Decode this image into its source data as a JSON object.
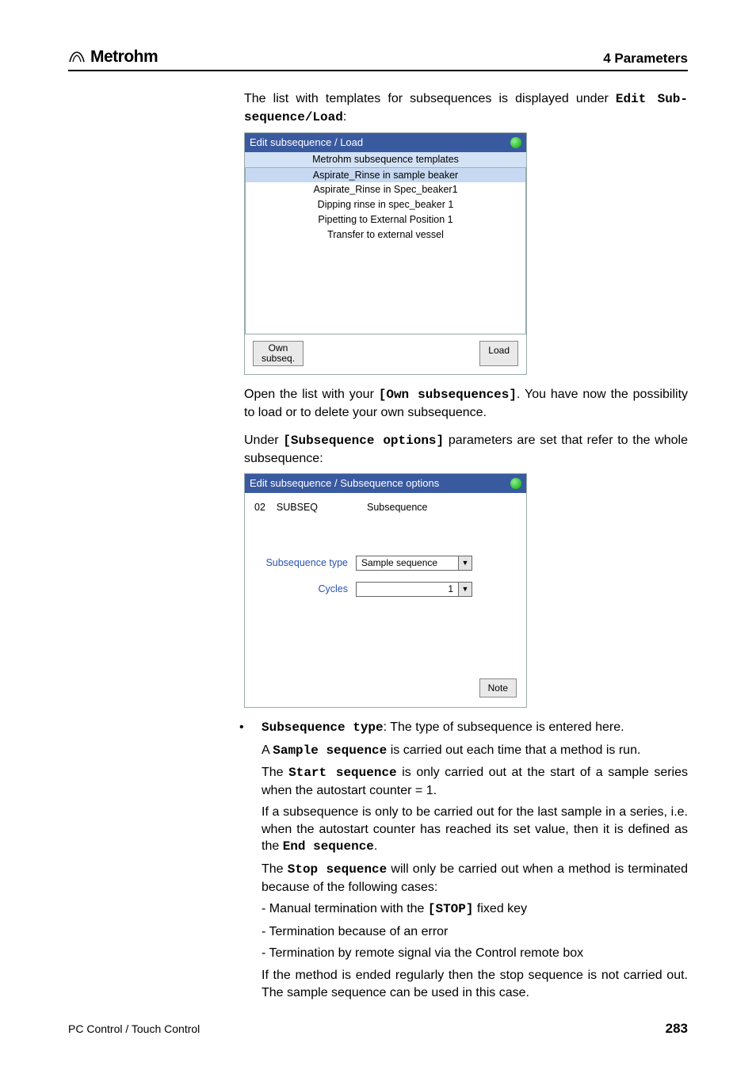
{
  "header": {
    "brand": "Metrohm",
    "chapter": "4 Parameters"
  },
  "intro": {
    "pre": "The list with templates for subsequences is displayed under ",
    "bold": "Edit Sub­sequence/Load",
    "post": ":"
  },
  "ss1": {
    "title": "Edit subsequence / Load",
    "header": "Metrohm subsequence templates",
    "rows": [
      "Aspirate_Rinse in sample beaker",
      "Aspirate_Rinse in Spec_beaker1",
      "Dipping rinse in spec_beaker 1",
      "Pipetting to External Position 1",
      "Transfer to external vessel"
    ],
    "own_btn_l1": "Own",
    "own_btn_l2": "subseq.",
    "load_btn": "Load"
  },
  "p2": {
    "pre": "Open the list with your ",
    "bold": "[Own subsequences]",
    "post": ". You have now the possi­bility to load or to delete your own subsequence."
  },
  "p3": {
    "pre": "Under ",
    "bold": "[Subsequence options]",
    "post": " parameters are set that refer to the whole subsequence:"
  },
  "ss2": {
    "title": "Edit subsequence / Subsequence options",
    "idx": "02",
    "code": "SUBSEQ",
    "name": "Subsequence",
    "type_label": "Subsequence type",
    "type_value": "Sample sequence",
    "cycles_label": "Cycles",
    "cycles_value": "1",
    "note_btn": "Note"
  },
  "bullet": {
    "lead_bold": "Subsequence type",
    "lead_rest": ": The type of subsequence is entered here.",
    "l1a": "A ",
    "l1b": "Sample sequence",
    "l1c": " is carried out each time that a method is run.",
    "l2a": "The ",
    "l2b": "Start sequence",
    "l2c": " is only carried out at the start of a sample se­ries when the autostart counter = 1.",
    "l3a": "If a subsequence is only to be carried out for the last sample in a series, i.e. when the autostart counter has reached its set value, then it is defined as the ",
    "l3b": "End sequence",
    "l3c": ".",
    "l4a": "The ",
    "l4b": "Stop sequence",
    "l4c": " will only be carried out when a method is termi­nated because of the following cases:",
    "d1a": "- Manual termination with the ",
    "d1b": "[STOP]",
    "d1c": " fixed key",
    "d2": "- Termination because of an error",
    "d3": "- Termination by remote signal via the Control remote box",
    "l5": "If the method is ended regularly then the stop sequence is not car­ried out. The sample sequence can be used in this case."
  },
  "footer": {
    "left": "PC Control / Touch Control",
    "page": "283"
  }
}
